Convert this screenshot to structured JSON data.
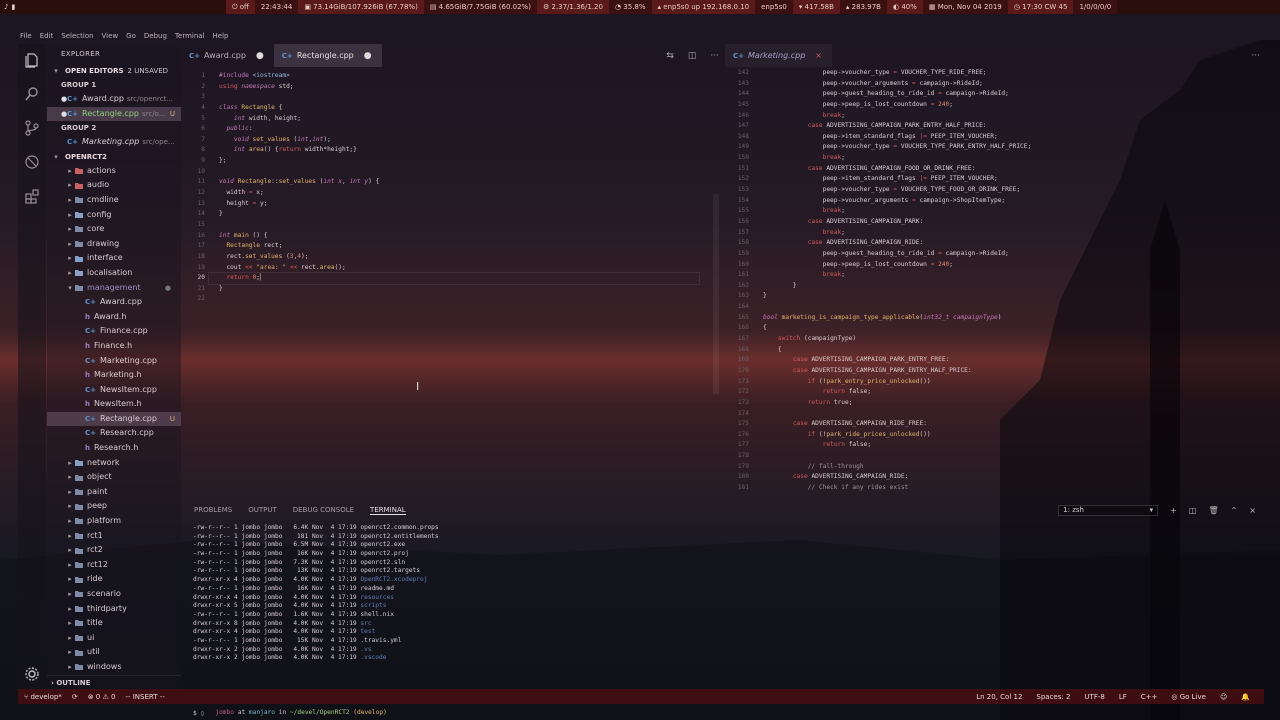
{
  "topbar": {
    "segments": [
      "off",
      "22:43:44",
      "73.14GiB/107.926iB (67.78%)",
      "4.65GiB/7.75GiB (60.02%)",
      "2.37/1.36/1.20",
      "35.8%",
      "enp5s0 up 192.168.0.10",
      "enp5s0",
      "417.58B",
      "283.97B",
      "40%",
      "Mon, Nov 04 2019",
      "17:30 CW 45",
      "1/0/0/0/0"
    ]
  },
  "menubar": [
    "File",
    "Edit",
    "Selection",
    "View",
    "Go",
    "Debug",
    "Terminal",
    "Help"
  ],
  "sidebar": {
    "title": "EXPLORER",
    "open_editors_label": "OPEN EDITORS",
    "unsaved_badge": "2 UNSAVED",
    "group1_label": "GROUP 1",
    "group2_label": "GROUP 2",
    "open_editors": [
      {
        "name": "Award.cpp",
        "path": "src/openrct...",
        "group": 1,
        "dirty": true
      },
      {
        "name": "Rectangle.cpp",
        "path": "src/o...",
        "group": 1,
        "dirty": true,
        "badge": "U"
      },
      {
        "name": "Marketing.cpp",
        "path": "src/ope...",
        "group": 2,
        "dirty": false
      }
    ],
    "project_label": "OPENRCT2",
    "folders_top": [
      "actions",
      "audio",
      "cmdline",
      "config",
      "core",
      "drawing",
      "interface",
      "localisation",
      "management"
    ],
    "management_files": [
      {
        "name": "Award.cpp",
        "type": "cpp"
      },
      {
        "name": "Award.h",
        "type": "h"
      },
      {
        "name": "Finance.cpp",
        "type": "cpp"
      },
      {
        "name": "Finance.h",
        "type": "h"
      },
      {
        "name": "Marketing.cpp",
        "type": "cpp"
      },
      {
        "name": "Marketing.h",
        "type": "h"
      },
      {
        "name": "NewsItem.cpp",
        "type": "cpp"
      },
      {
        "name": "NewsItem.h",
        "type": "h"
      },
      {
        "name": "Rectangle.cpp",
        "type": "cpp",
        "badge": "U"
      },
      {
        "name": "Research.cpp",
        "type": "cpp"
      },
      {
        "name": "Research.h",
        "type": "h"
      }
    ],
    "folders_bottom": [
      "network",
      "object",
      "paint",
      "peep",
      "platform",
      "rct1",
      "rct2",
      "rct12",
      "ride",
      "scenario",
      "thirdparty",
      "title",
      "ui",
      "util",
      "windows"
    ],
    "outline_label": "OUTLINE"
  },
  "editor1": {
    "tabs": [
      {
        "label": "Award.cpp",
        "dirty": true
      },
      {
        "label": "Rectangle.cpp",
        "dirty": true
      }
    ],
    "lines": [
      "1",
      "2",
      "3",
      "4",
      "5",
      "6",
      "7",
      "8",
      "9",
      "10",
      "11",
      "12",
      "13",
      "14",
      "15",
      "16",
      "17",
      "18",
      "19",
      "20",
      "21",
      "22"
    ],
    "current_line": "20"
  },
  "editor2": {
    "tab": "Marketing.cpp",
    "line_numbers": [
      "142",
      "143",
      "144",
      "145",
      "146",
      "147",
      "148",
      "149",
      "150",
      "151",
      "152",
      "153",
      "154",
      "155",
      "156",
      "157",
      "158",
      "159",
      "160",
      "161",
      "162",
      "163",
      "164",
      "165",
      "166",
      "167",
      "168",
      "169",
      "170",
      "171",
      "172",
      "173",
      "174",
      "175",
      "176",
      "177",
      "178",
      "179",
      "180",
      "181"
    ]
  },
  "panel": {
    "tabs": [
      "PROBLEMS",
      "OUTPUT",
      "DEBUG CONSOLE",
      "TERMINAL"
    ],
    "active_tab": "TERMINAL",
    "terminal_select": "1: zsh",
    "listing": [
      {
        "perm": "-rw-r--r--",
        "n": "1",
        "u": "jombo",
        "g": "jombo",
        "size": "6.4K",
        "date": "Nov  4 17:19",
        "name": "openrct2.common.props",
        "dir": false
      },
      {
        "perm": "-rw-r--r--",
        "n": "1",
        "u": "jombo",
        "g": "jombo",
        "size": "181",
        "date": "Nov  4 17:19",
        "name": "openrct2.entitlements",
        "dir": false
      },
      {
        "perm": "-rw-r--r--",
        "n": "1",
        "u": "jombo",
        "g": "jombo",
        "size": "6.5M",
        "date": "Nov  4 17:19",
        "name": "openrct2.exe",
        "dir": false
      },
      {
        "perm": "-rw-r--r--",
        "n": "1",
        "u": "jombo",
        "g": "jombo",
        "size": "16K",
        "date": "Nov  4 17:19",
        "name": "openrct2.proj",
        "dir": false
      },
      {
        "perm": "-rw-r--r--",
        "n": "1",
        "u": "jombo",
        "g": "jombo",
        "size": "7.3K",
        "date": "Nov  4 17:19",
        "name": "openrct2.sln",
        "dir": false
      },
      {
        "perm": "-rw-r--r--",
        "n": "1",
        "u": "jombo",
        "g": "jombo",
        "size": "13K",
        "date": "Nov  4 17:19",
        "name": "openrct2.targets",
        "dir": false
      },
      {
        "perm": "drwxr-xr-x",
        "n": "4",
        "u": "jombo",
        "g": "jombo",
        "size": "4.0K",
        "date": "Nov  4 17:19",
        "name": "OpenRCT2.xcodeproj",
        "dir": true
      },
      {
        "perm": "-rw-r--r--",
        "n": "1",
        "u": "jombo",
        "g": "jombo",
        "size": "16K",
        "date": "Nov  4 17:19",
        "name": "readme.md",
        "dir": false
      },
      {
        "perm": "drwxr-xr-x",
        "n": "4",
        "u": "jombo",
        "g": "jombo",
        "size": "4.0K",
        "date": "Nov  4 17:19",
        "name": "resources",
        "dir": true
      },
      {
        "perm": "drwxr-xr-x",
        "n": "5",
        "u": "jombo",
        "g": "jombo",
        "size": "4.0K",
        "date": "Nov  4 17:19",
        "name": "scripts",
        "dir": true
      },
      {
        "perm": "-rw-r--r--",
        "n": "1",
        "u": "jombo",
        "g": "jombo",
        "size": "1.6K",
        "date": "Nov  4 17:19",
        "name": "shell.nix",
        "dir": false
      },
      {
        "perm": "drwxr-xr-x",
        "n": "8",
        "u": "jombo",
        "g": "jombo",
        "size": "4.0K",
        "date": "Nov  4 17:19",
        "name": "src",
        "dir": true
      },
      {
        "perm": "drwxr-xr-x",
        "n": "4",
        "u": "jombo",
        "g": "jombo",
        "size": "4.0K",
        "date": "Nov  4 17:19",
        "name": "test",
        "dir": true
      },
      {
        "perm": "-rw-r--r--",
        "n": "1",
        "u": "jombo",
        "g": "jombo",
        "size": "15K",
        "date": "Nov  4 17:19",
        "name": ".travis.yml",
        "dir": false
      },
      {
        "perm": "drwxr-xr-x",
        "n": "2",
        "u": "jombo",
        "g": "jombo",
        "size": "4.0K",
        "date": "Nov  4 17:19",
        "name": ".vs",
        "dir": true
      },
      {
        "perm": "drwxr-xr-x",
        "n": "2",
        "u": "jombo",
        "g": "jombo",
        "size": "4.0K",
        "date": "Nov  4 17:19",
        "name": ".vscode",
        "dir": true
      }
    ],
    "prompt_user": "jombo",
    "prompt_at": "at",
    "prompt_host": "manjaro",
    "prompt_in": "in",
    "prompt_path": "~/devel/OpenRCT2",
    "prompt_branch": "(develop)",
    "prompt_symbol": "$"
  },
  "statusbar": {
    "branch": "develop*",
    "errors": "0",
    "warnings": "0",
    "mode": "-- INSERT --",
    "position": "Ln 20, Col 12",
    "spaces": "Spaces: 2",
    "encoding": "UTF-8",
    "eol": "LF",
    "language": "C++",
    "live": "Go Live"
  }
}
